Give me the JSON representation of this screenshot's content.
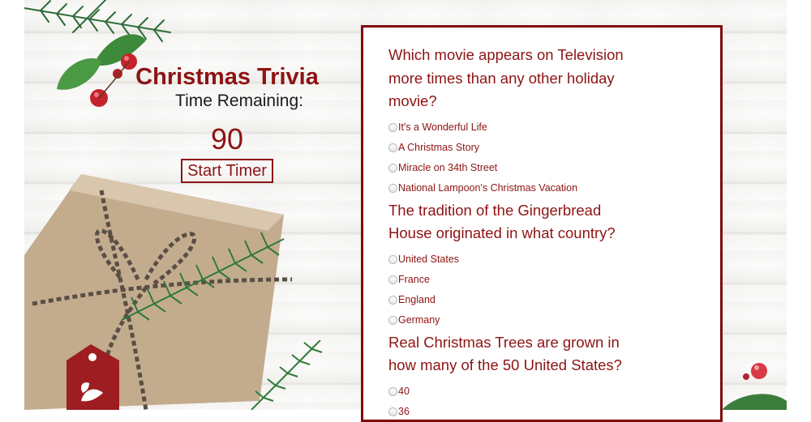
{
  "sidebar": {
    "title": "Christmas Trivia",
    "time_label": "Time Remaining:",
    "timer_value": "90",
    "start_button": "Start Timer"
  },
  "questions": [
    {
      "text": "Which movie appears on Television more times than any other holiday movie?",
      "options": [
        "It's a Wonderful Life",
        "A Christmas Story",
        "Miracle on 34th Street",
        "National Lampoon's Christmas Vacation"
      ]
    },
    {
      "text": "The tradition of the Gingerbread House originated in what country?",
      "options": [
        "United States",
        "France",
        "England",
        "Germany"
      ]
    },
    {
      "text": "Real Christmas Trees are grown in how many of the 50 United States?",
      "options": [
        "40",
        "36"
      ]
    }
  ],
  "colors": {
    "accent": "#8e1313",
    "border": "#7e0d0d",
    "background": "#f6f5f3"
  },
  "icons": [
    "pine-branch-icon",
    "holly-berries-icon",
    "gift-box-icon",
    "gift-tag-icon"
  ]
}
